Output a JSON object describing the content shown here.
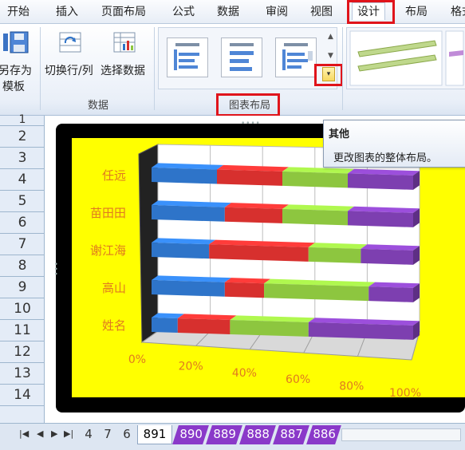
{
  "menu": {
    "tabs": [
      {
        "label": "开始"
      },
      {
        "label": "插入"
      },
      {
        "label": "页面布局"
      },
      {
        "label": "公式"
      },
      {
        "label": "数据"
      },
      {
        "label": "审阅"
      },
      {
        "label": "视图"
      },
      {
        "label": "设计",
        "active": true
      },
      {
        "label": "布局"
      },
      {
        "label": "格式"
      }
    ]
  },
  "ribbon": {
    "save_template_label_line1": "另存为",
    "save_template_label_line2": "模板",
    "switch_rowcol_label": "切换行/列",
    "select_data_label": "选择数据",
    "group_data_label": "数据",
    "group_chart_layout_label": "图表布局",
    "more_button_glyph": "▾"
  },
  "tooltip": {
    "title": "其他",
    "description": "更改图表的整体布局。"
  },
  "rows": [
    "1",
    "2",
    "3",
    "4",
    "5",
    "6",
    "7",
    "8",
    "9",
    "10",
    "11",
    "12",
    "13",
    "14"
  ],
  "chart_data": {
    "type": "bar",
    "stacked": "100%",
    "view": "3d",
    "categories": [
      "任远",
      "苗田田",
      "谢江海",
      "高山",
      "姓名"
    ],
    "series": [
      {
        "color": "#2e74c9",
        "values": [
          0.25,
          0.28,
          0.22,
          0.28,
          0.1
        ]
      },
      {
        "color": "#d7302e",
        "values": [
          0.25,
          0.22,
          0.38,
          0.15,
          0.2
        ]
      },
      {
        "color": "#8dc63f",
        "values": [
          0.25,
          0.25,
          0.2,
          0.4,
          0.3
        ]
      },
      {
        "color": "#7d3fb0",
        "values": [
          0.25,
          0.25,
          0.2,
          0.17,
          0.4
        ]
      }
    ],
    "x_ticks": [
      "0%",
      "20%",
      "40%",
      "60%",
      "80%",
      "100%"
    ],
    "xlim": [
      0,
      1
    ],
    "background": "#ffff00",
    "label_color": "#e07a20"
  },
  "sheets": {
    "tabs": [
      {
        "label": "4"
      },
      {
        "label": "7"
      },
      {
        "label": "6"
      },
      {
        "label": "891",
        "active": true
      },
      {
        "label": "890",
        "purple": true
      },
      {
        "label": "889",
        "purple": true
      },
      {
        "label": "888",
        "purple": true
      },
      {
        "label": "887",
        "purple": true
      },
      {
        "label": "886",
        "purple": true
      }
    ]
  },
  "colors": {
    "highlight_box": "#e0141b",
    "purple_tab": "#8a39c9"
  }
}
